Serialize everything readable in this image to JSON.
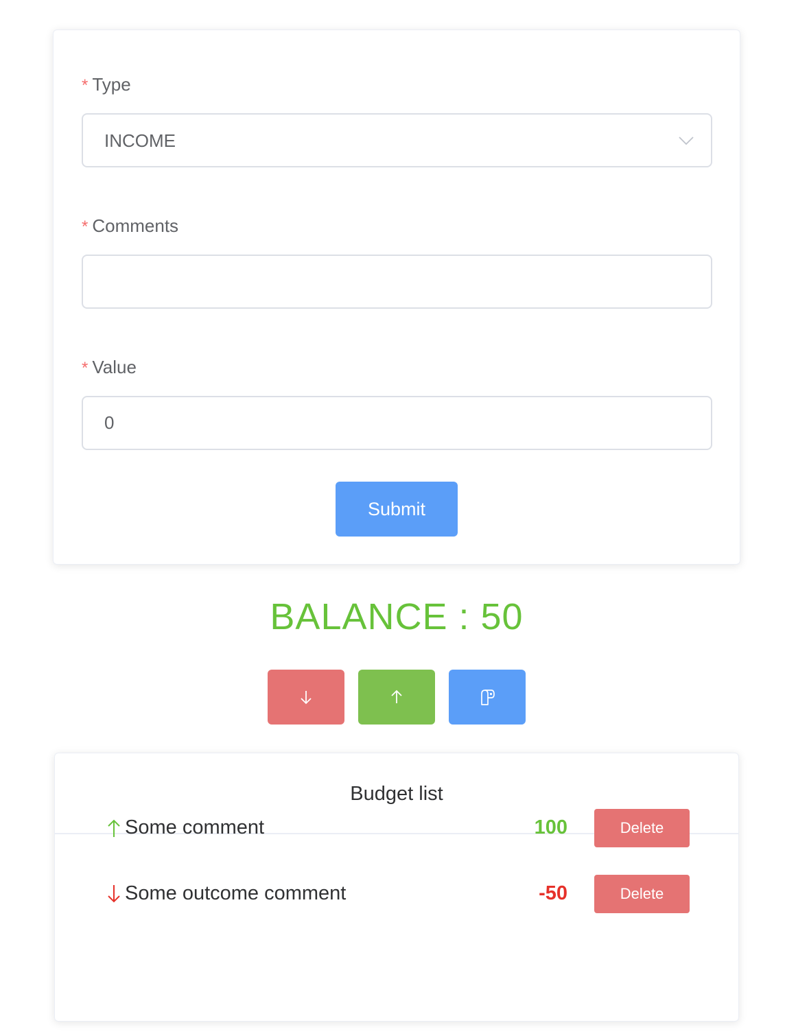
{
  "form": {
    "type_label": "Type",
    "type_value": "INCOME",
    "comments_label": "Comments",
    "comments_value": "",
    "value_label": "Value",
    "value_value": "0",
    "required_mark": "*",
    "submit_label": "Submit"
  },
  "balance": {
    "text": "BALANCE : 50"
  },
  "actions": {
    "outcome_icon": "arrow-down-icon",
    "income_icon": "arrow-up-icon",
    "reset_icon": "toilet-paper-icon"
  },
  "budget_list": {
    "title": "Budget list",
    "items": [
      {
        "direction": "up",
        "comment": "Some comment",
        "value": "100",
        "delete_label": "Delete"
      },
      {
        "direction": "down",
        "comment": "Some outcome comment",
        "value": "-50",
        "delete_label": "Delete"
      }
    ]
  },
  "colors": {
    "primary": "#5b9ef8",
    "danger": "#e57373",
    "success": "#7ec04f",
    "income_text": "#67c23a",
    "outcome_text": "#e6312a",
    "required": "#f56c6c"
  }
}
